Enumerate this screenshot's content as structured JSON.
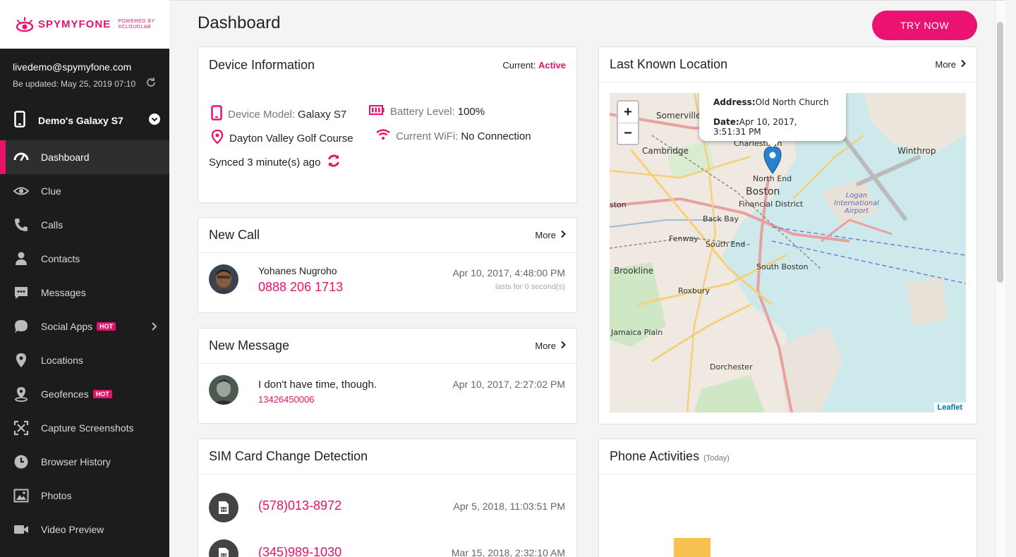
{
  "brand": {
    "name": "SPYMYFONE",
    "powered_line1": "POWERED BY",
    "powered_line2": "XCLOUDLAB"
  },
  "account": {
    "email": "livedemo@spymyfone.com",
    "updated": "Be updated: May 25, 2019 07:10"
  },
  "device": {
    "name": "Demo's Galaxy S7"
  },
  "nav": [
    {
      "label": "Dashboard",
      "icon": "dashboard-icon"
    },
    {
      "label": "Clue",
      "icon": "eye-icon"
    },
    {
      "label": "Calls",
      "icon": "phone-icon"
    },
    {
      "label": "Contacts",
      "icon": "person-icon"
    },
    {
      "label": "Messages",
      "icon": "message-icon"
    },
    {
      "label": "Social Apps",
      "icon": "chat-bubble-icon",
      "badge": "HOT"
    },
    {
      "label": "Locations",
      "icon": "location-pin-icon"
    },
    {
      "label": "Geofences",
      "icon": "geofence-icon",
      "badge": "HOT"
    },
    {
      "label": "Capture Screenshots",
      "icon": "screenshot-icon"
    },
    {
      "label": "Browser History",
      "icon": "clock-icon"
    },
    {
      "label": "Photos",
      "icon": "photo-icon"
    },
    {
      "label": "Video Preview",
      "icon": "video-icon"
    }
  ],
  "header": {
    "title": "Dashboard",
    "try_now": "TRY NOW"
  },
  "device_info": {
    "title": "Device Information",
    "current_label": "Current:",
    "current_value": "Active",
    "model_label": "Device Model:",
    "model_value": "Galaxy S7",
    "battery_label": "Battery Level:",
    "battery_value": "100%",
    "location": "Dayton Valley Golf Course",
    "wifi_label": "Current WiFi:",
    "wifi_value": "No Connection",
    "synced": "Synced 3 minute(s) ago"
  },
  "new_call": {
    "title": "New Call",
    "more": "More",
    "name": "Yohanes Nugroho",
    "number": "0888 206 1713",
    "time": "Apr 10, 2017, 4:48:00 PM",
    "duration": "lasts for 0 second(s)"
  },
  "new_message": {
    "title": "New Message",
    "more": "More",
    "text": "I don't have time, though.",
    "number": "13426450006",
    "time": "Apr 10, 2017, 2:27:02 PM"
  },
  "sim": {
    "title": "SIM Card Change Detection",
    "items": [
      {
        "number": "(578)013-8972",
        "time": "Apr 5, 2018, 11:03:51 PM"
      },
      {
        "number": "(345)989-1030",
        "time": "Mar 15, 2018, 2:32:10 AM"
      }
    ]
  },
  "location": {
    "title": "Last Known Location",
    "more": "More",
    "address_label": "Address:",
    "address_value": "Old North Church",
    "date_label": "Date:",
    "date_value": "Apr 10, 2017, 3:51:31 PM",
    "attribution": "Leaflet",
    "zoom_in": "+",
    "zoom_out": "−",
    "places": [
      "Somerville",
      "Cambridge",
      "Charlestown",
      "Winthrop",
      "North End",
      "Boston",
      "Financial District",
      "Logan International Airport",
      "Back Bay",
      "Fenway",
      "South End",
      "Brookline",
      "South Boston",
      "Roxbury",
      "Jamaica Plain",
      "Dorchester",
      "ston"
    ]
  },
  "activities": {
    "title": "Phone Activities",
    "subtitle": "(Today)"
  },
  "colors": {
    "accent": "#e6136d",
    "sidebar": "#1c1c1c",
    "bar": "#f9c14f"
  }
}
